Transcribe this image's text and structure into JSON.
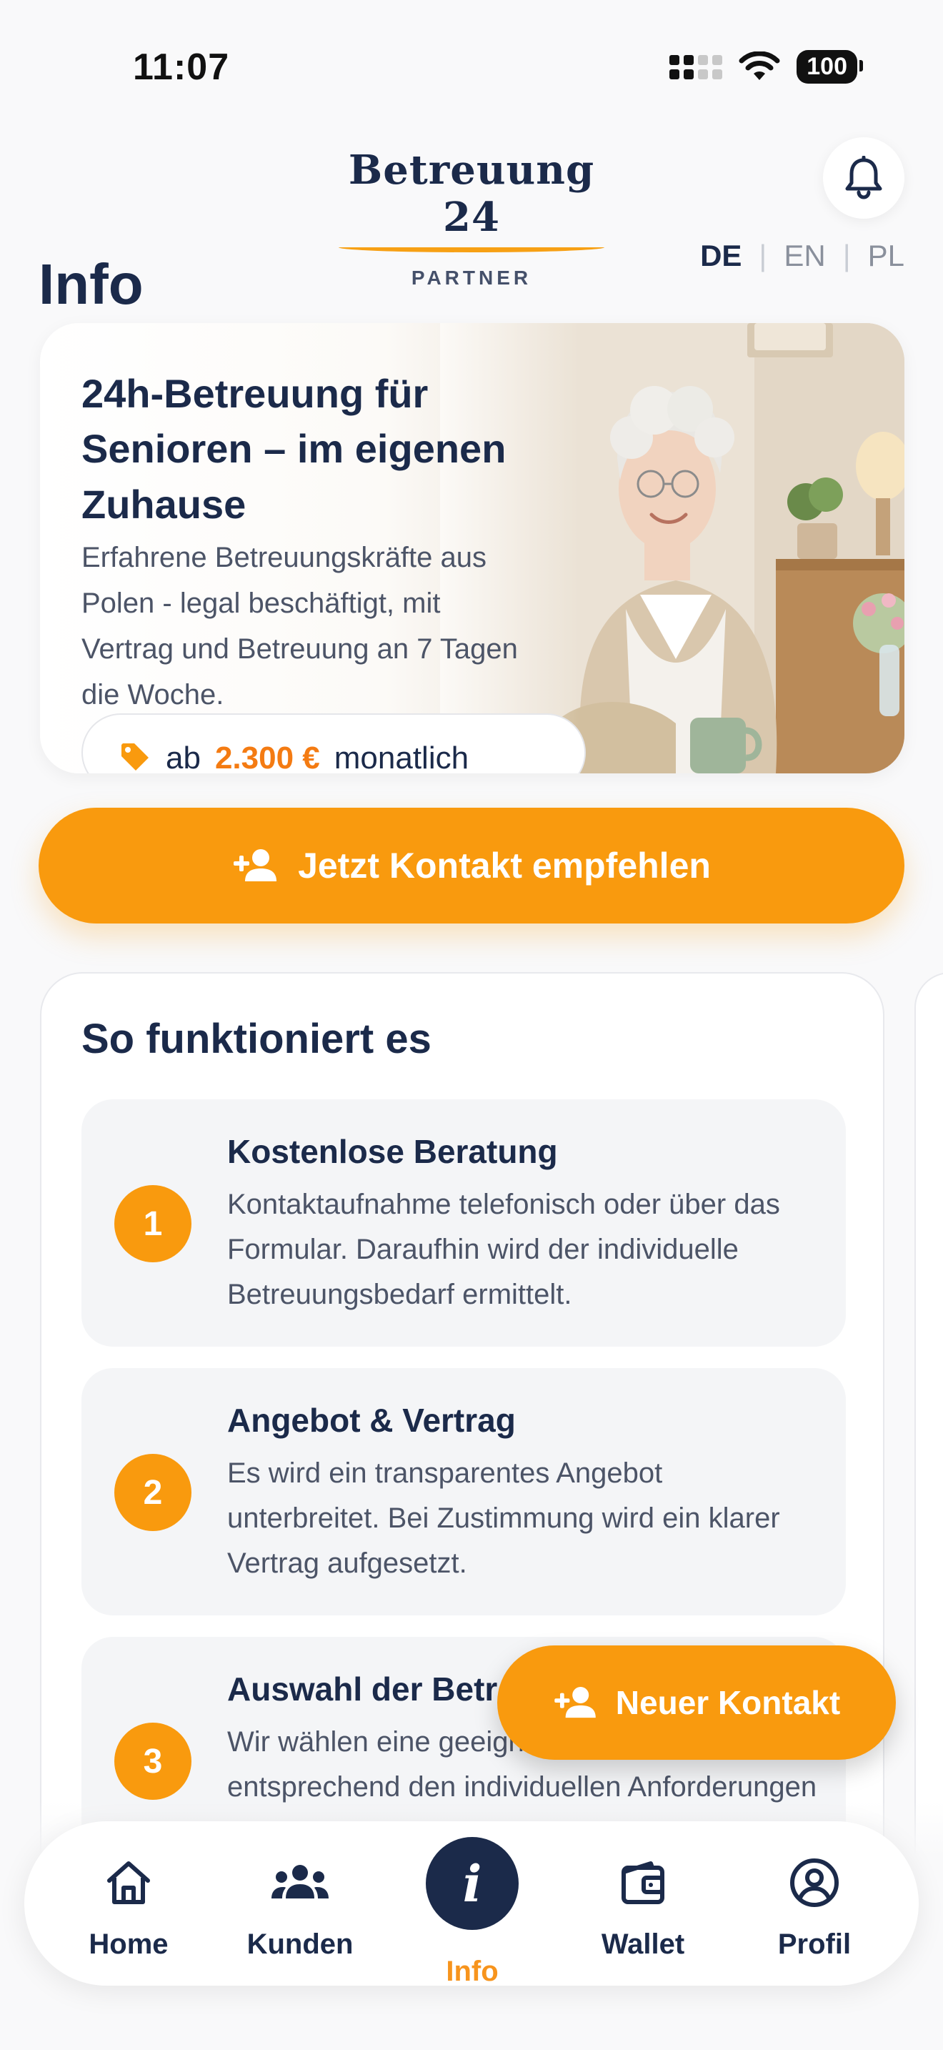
{
  "status_bar": {
    "time": "11:07",
    "battery": "100"
  },
  "header": {
    "brand": "Betreuung 24",
    "sub": "PARTNER",
    "languages": [
      "DE",
      "EN",
      "PL"
    ],
    "active_language": "DE"
  },
  "page": {
    "title": "Info"
  },
  "hero": {
    "title": "24h-Betreuung für Senioren – im eigenen Zuhause",
    "description": "Erfahrene Betreuungskräfte aus Polen - legal beschäftigt, mit Vertrag und Betreuung an 7 Tagen die Woche.",
    "price_prefix": "ab",
    "price": "2.300 €",
    "price_suffix": "monatlich"
  },
  "cta": {
    "label": "Jetzt Kontakt empfehlen"
  },
  "steps": {
    "title": "So funktioniert es",
    "items": [
      {
        "num": "1",
        "title": "Kostenlose Beratung",
        "desc": "Kontaktaufnahme telefonisch oder über das Formular. Daraufhin wird der individuelle Betreuungsbedarf ermittelt."
      },
      {
        "num": "2",
        "title": "Angebot & Vertrag",
        "desc": "Es wird ein transparentes Angebot unterbreitet. Bei Zustimmung wird ein klarer Vertrag aufgesetzt."
      },
      {
        "num": "3",
        "title": "Auswahl der Betreuungskraft",
        "desc": "Wir wählen eine geeignete Betreuungskraft entsprechend den individuellen Anforderungen aus."
      }
    ]
  },
  "fab": {
    "label": "Neuer Kontakt"
  },
  "nav": {
    "items": [
      {
        "label": "Home",
        "icon": "home-icon"
      },
      {
        "label": "Kunden",
        "icon": "users-icon"
      },
      {
        "label": "Info",
        "icon": "info-icon"
      },
      {
        "label": "Wallet",
        "icon": "wallet-icon"
      },
      {
        "label": "Profil",
        "icon": "profile-icon"
      }
    ],
    "active": "Info"
  },
  "colors": {
    "accent": "#f99a0e",
    "navy": "#1b2a4a",
    "price": "#f47b12"
  }
}
